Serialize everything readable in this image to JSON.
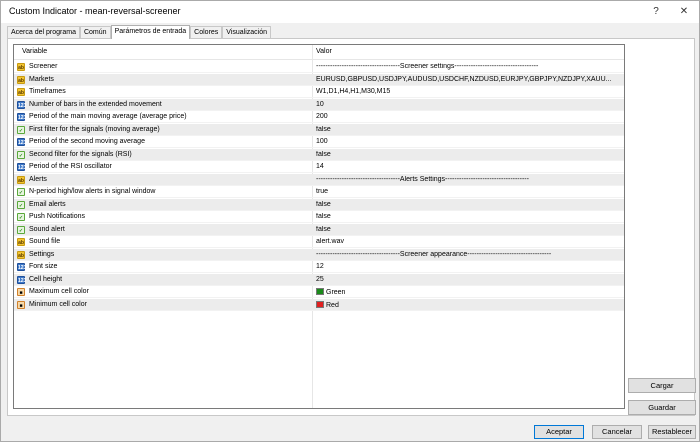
{
  "window": {
    "title": "Custom Indicator - mean-reversal-screener",
    "help_label": "?",
    "close_label": "✕"
  },
  "tabs": [
    {
      "label": "Acerca del programa",
      "active": false
    },
    {
      "label": "Común",
      "active": false
    },
    {
      "label": "Parámetros de entrada",
      "active": true
    },
    {
      "label": "Colores",
      "active": false
    },
    {
      "label": "Visualización",
      "active": false
    }
  ],
  "grid": {
    "col_variable": "Variable",
    "col_value": "Valor",
    "rows": [
      {
        "icon": "string-icon",
        "name": "Screener",
        "value": "------------------------------------Screener settings------------------------------------"
      },
      {
        "icon": "string-icon",
        "name": "Markets",
        "value": "EURUSD,GBPUSD,USDJPY,AUDUSD,USDCHF,NZDUSD,EURJPY,GBPJPY,NZDJPY,XAUU..."
      },
      {
        "icon": "string-icon",
        "name": "Timeframes",
        "value": "W1,D1,H4,H1,M30,M15"
      },
      {
        "icon": "integer-icon",
        "name": "Number of bars in the extended movement",
        "value": "10"
      },
      {
        "icon": "integer-icon",
        "name": "Period of the main moving average (average price)",
        "value": "200"
      },
      {
        "icon": "boolean-icon",
        "name": "First filter for the signals (moving average)",
        "value": "false"
      },
      {
        "icon": "integer-icon",
        "name": "Period of the second moving average",
        "value": "100"
      },
      {
        "icon": "boolean-icon",
        "name": "Second filter for the signals (RSI)",
        "value": "false"
      },
      {
        "icon": "integer-icon",
        "name": "Period of the RSI oscillator",
        "value": "14"
      },
      {
        "icon": "string-icon",
        "name": "Alerts",
        "value": "------------------------------------Alerts Settings------------------------------------"
      },
      {
        "icon": "boolean-icon",
        "name": "N-period high/low alerts in signal window",
        "value": "true"
      },
      {
        "icon": "boolean-icon",
        "name": "Email alerts",
        "value": "false"
      },
      {
        "icon": "boolean-icon",
        "name": "Push Notifications",
        "value": "false"
      },
      {
        "icon": "boolean-icon",
        "name": "Sound alert",
        "value": "false"
      },
      {
        "icon": "string-icon",
        "name": "Sound file",
        "value": "alert.wav"
      },
      {
        "icon": "string-icon",
        "name": "Settings",
        "value": "------------------------------------Screener appearance------------------------------------"
      },
      {
        "icon": "integer-icon",
        "name": "Font size",
        "value": "12"
      },
      {
        "icon": "integer-icon",
        "name": "Cell height",
        "value": "25"
      },
      {
        "icon": "color-icon",
        "name": "Maximum cell color",
        "value": "Green",
        "swatch": "#1a8a1a"
      },
      {
        "icon": "color-icon",
        "name": "Minimum cell color",
        "value": "Red",
        "swatch": "#e02020"
      }
    ]
  },
  "side_buttons": {
    "load": "Cargar",
    "save": "Guardar"
  },
  "footer_buttons": {
    "ok": "Aceptar",
    "cancel": "Cancelar",
    "reset": "Restablecer"
  }
}
